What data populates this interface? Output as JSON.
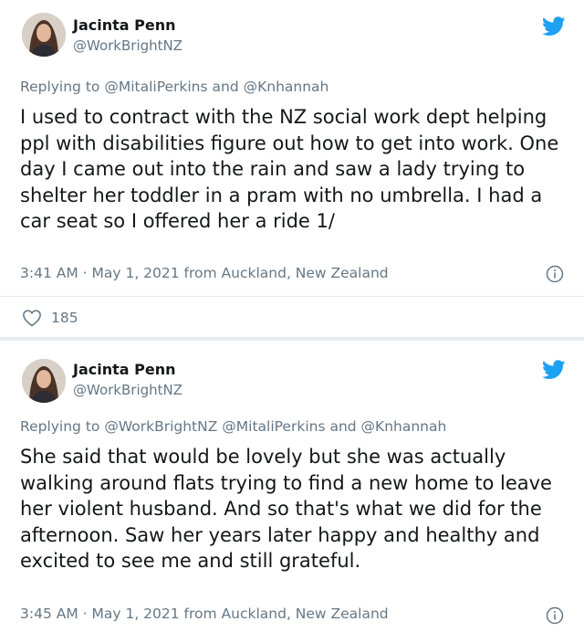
{
  "tweets": [
    {
      "author_name": "Jacinta Penn",
      "author_handle": "@WorkBrightNZ",
      "replying_prefix": "Replying to",
      "replying_to": "@MitaliPerkins and @Knhannah",
      "text": "I used to contract with the NZ social work dept helping ppl with disabilities figure out how to get into work. One day I came out into the rain and saw a lady trying to shelter her toddler in a pram with no umbrella. I had a car seat so I offered her a ride 1/",
      "timestamp": "3:41 AM · May 1, 2021 from Auckland, New Zealand",
      "likes": "185"
    },
    {
      "author_name": "Jacinta Penn",
      "author_handle": "@WorkBrightNZ",
      "replying_prefix": "Replying to",
      "replying_to": "@WorkBrightNZ @MitaliPerkins and @Knhannah",
      "text": "She said that would be lovely but she was actually walking around flats trying to find a new home to leave her violent husband. And so that's what we did for the afternoon. Saw her years later happy and healthy and excited to see me and still grateful.",
      "timestamp": "3:45 AM · May 1, 2021 from Auckland, New Zealand"
    }
  ],
  "colors": {
    "twitter_blue": "#1da1f2",
    "secondary_text": "#657786",
    "divider": "#e1e8ed"
  },
  "icons": [
    "twitter-bird-icon",
    "info-icon",
    "heart-icon"
  ]
}
